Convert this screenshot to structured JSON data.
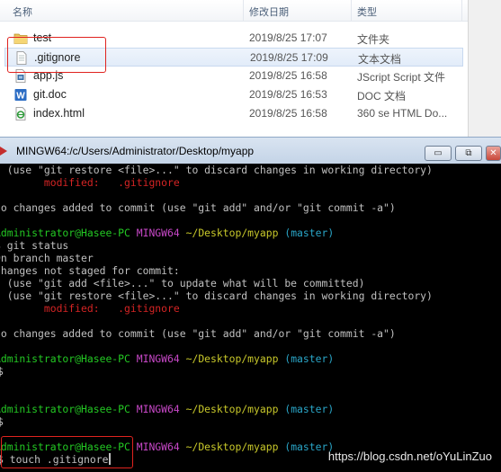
{
  "explorer": {
    "columns": {
      "name": "名称",
      "date": "修改日期",
      "type": "类型"
    },
    "files": [
      {
        "name": "test",
        "date": "2019/8/25 17:07",
        "type": "文件夹",
        "icon": "folder-icon"
      },
      {
        "name": ".gitignore",
        "date": "2019/8/25 17:09",
        "type": "文本文档",
        "icon": "text-file-icon"
      },
      {
        "name": "app.js",
        "date": "2019/8/25 16:58",
        "type": "JScript Script 文件",
        "icon": "js-file-icon"
      },
      {
        "name": "git.doc",
        "date": "2019/8/25 16:53",
        "type": "DOC 文档",
        "icon": "word-file-icon"
      },
      {
        "name": "index.html",
        "date": "2019/8/25 16:58",
        "type": "360 se HTML Do...",
        "icon": "html-file-icon"
      }
    ]
  },
  "terminal": {
    "title": "MINGW64:/c/Users/Administrator/Desktop/myapp",
    "buttons": {
      "minimize": "▭",
      "restore": "⧉",
      "close": "✕"
    },
    "lines": {
      "l1": "  (use \"git restore <file>...\" to discard changes in working directory)",
      "l2_label": "        modified:   ",
      "l2_file": ".gitignore",
      "l3": "no changes added to commit (use \"git add\" and/or \"git commit -a\")",
      "p1_user": "Administrator@Hasee-PC",
      "p1_sys": "MINGW64",
      "p1_path": "~/Desktop/myapp",
      "p1_branch": "(master)",
      "cmd1": "$ git status",
      "l5": "On branch master",
      "l6": "Changes not staged for commit:",
      "l7": "  (use \"git add <file>...\" to update what will be committed)",
      "l8": "  (use \"git restore <file>...\" to discard changes in working directory)",
      "l9_label": "        modified:   ",
      "l9_file": ".gitignore",
      "l10": "no changes added to commit (use \"git add\" and/or \"git commit -a\")",
      "dollar": "$",
      "cmd_last": "$ touch .gitignore"
    }
  },
  "watermark": "https://blog.csdn.net/oYuLinZuo",
  "colors": {
    "user": "#23c823",
    "system": "#c848c8",
    "path": "#c8c82a",
    "branch": "#2aa6c8",
    "modified": "#d42424",
    "highlight": "#e0231f"
  }
}
